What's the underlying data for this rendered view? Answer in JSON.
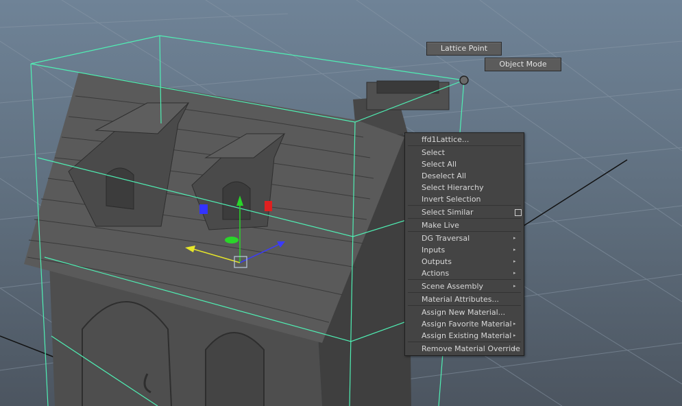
{
  "hotbox": {
    "lattice_point": "Lattice Point",
    "object_mode": "Object Mode"
  },
  "context_menu": {
    "title": "ffd1Lattice...",
    "items": [
      {
        "label": "Select"
      },
      {
        "label": "Select All"
      },
      {
        "label": "Deselect All"
      },
      {
        "label": "Select Hierarchy"
      },
      {
        "label": "Invert Selection"
      },
      {
        "label": "Select Similar"
      },
      {
        "label": "Make Live"
      },
      {
        "label": "DG Traversal"
      },
      {
        "label": "Inputs"
      },
      {
        "label": "Outputs"
      },
      {
        "label": "Actions"
      },
      {
        "label": "Scene Assembly"
      },
      {
        "label": "Material Attributes..."
      },
      {
        "label": "Assign New Material..."
      },
      {
        "label": "Assign Favorite Material"
      },
      {
        "label": "Assign Existing Material"
      },
      {
        "label": "Remove Material Override"
      }
    ],
    "submenu_arrow_glyph": "▸"
  },
  "colors": {
    "viewport_top": "#6f8397",
    "viewport_bottom": "#4c5560",
    "lattice": "#4ff0b4",
    "grid": "#8b99a8",
    "menu_bg": "#444444",
    "menu_text": "#d8d8d8"
  }
}
